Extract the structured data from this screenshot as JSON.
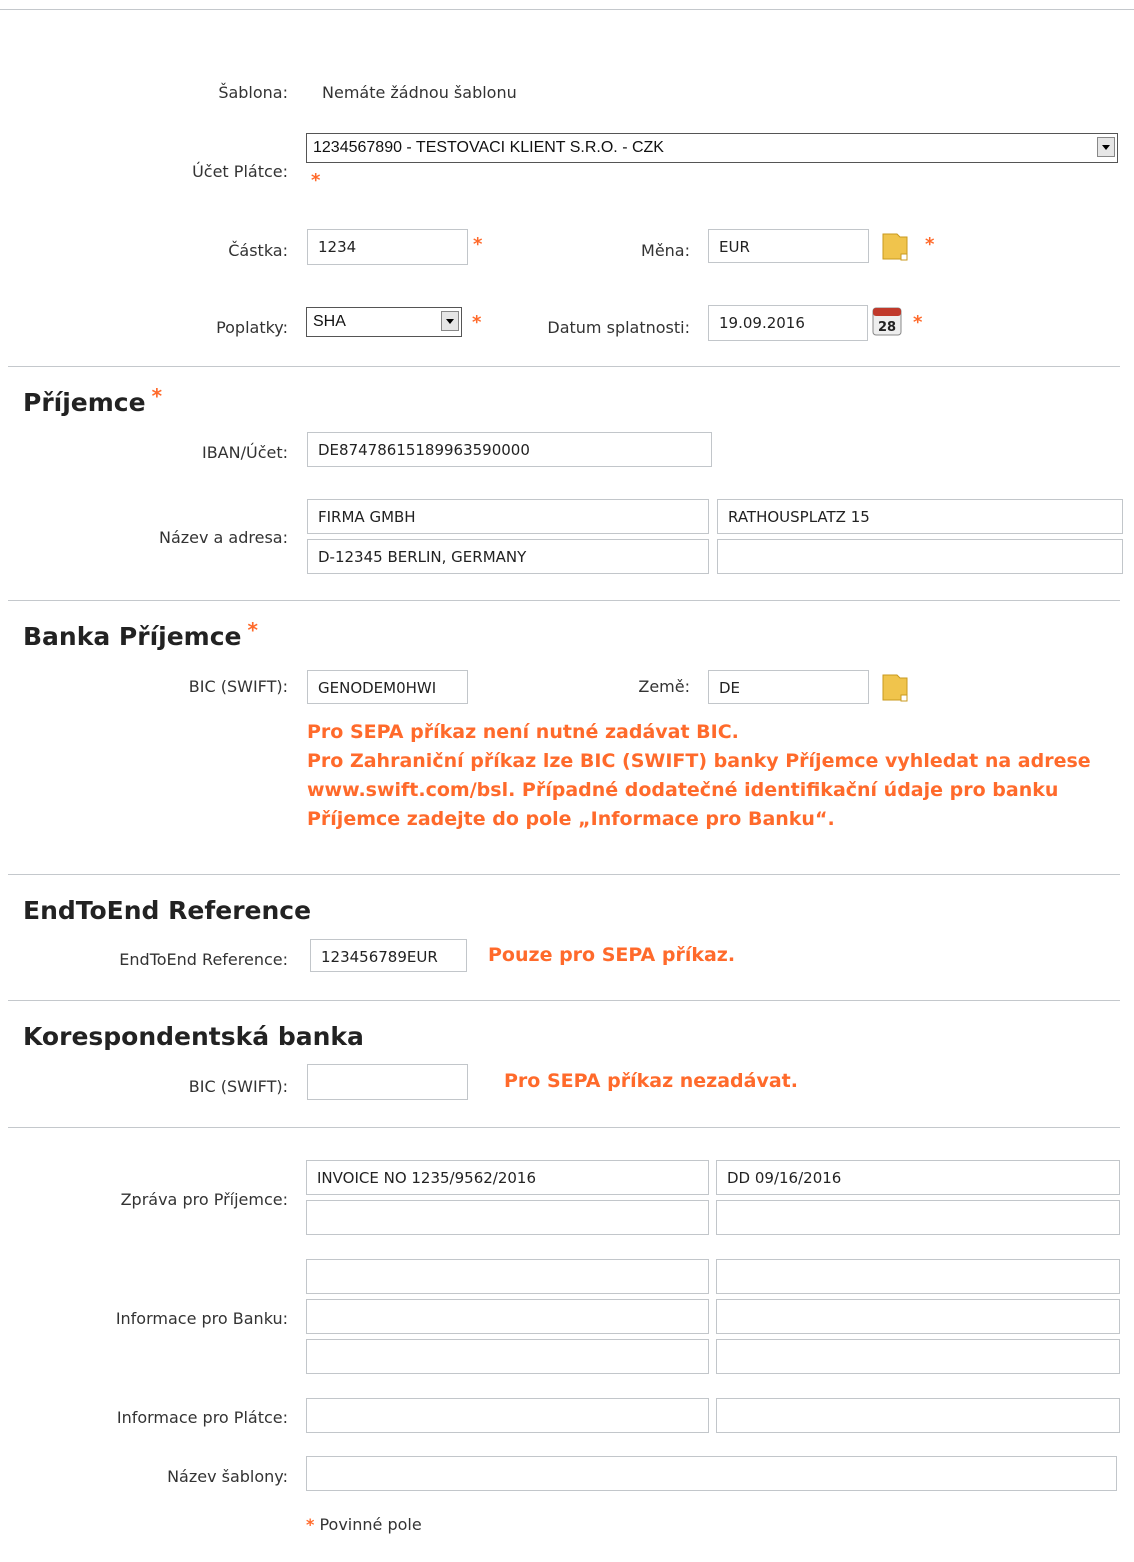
{
  "sablona": {
    "label": "Šablona:",
    "value": "Nemáte žádnou šablonu"
  },
  "ucet": {
    "label": "Účet Plátce:",
    "selected": "1234567890 - TESTOVACI KLIENT S.R.O. - CZK"
  },
  "castka": {
    "label": "Částka:",
    "value": "1234"
  },
  "mena": {
    "label": "Měna:",
    "value": "EUR"
  },
  "poplatky": {
    "label": "Poplatky:",
    "selected": "SHA"
  },
  "datum": {
    "label": "Datum splatnosti:",
    "value": "19.09.2016",
    "calendar_day": "28"
  },
  "required_mark": "*",
  "prijemce": {
    "heading": "Příjemce",
    "iban_label": "IBAN/Účet:",
    "iban_value": "DE87478615189963590000",
    "name_label": "Název a adresa:",
    "name_fields": [
      "FIRMA GMBH",
      "RATHOUSPLATZ 15",
      "D-12345 BERLIN, GERMANY",
      ""
    ]
  },
  "banka": {
    "heading": "Banka Příjemce",
    "bic_label": "BIC (SWIFT):",
    "bic_value": "GENODEM0HWI",
    "zeme_label": "Země:",
    "zeme_value": "DE",
    "notes": [
      "Pro SEPA příkaz není nutné zadávat BIC.",
      "Pro Zahraniční příkaz lze BIC (SWIFT) banky Příjemce vyhledat na adrese",
      "www.swift.com/bsl. Případné dodatečné identifikační údaje pro banku",
      "Příjemce zadejte do pole „Informace pro Banku“."
    ]
  },
  "endtoend": {
    "heading": "EndToEnd Reference",
    "label": "EndToEnd Reference:",
    "value": "123456789EUR",
    "note": "Pouze pro SEPA příkaz."
  },
  "koresp": {
    "heading": "Korespondentská banka",
    "label": "BIC (SWIFT):",
    "value": "",
    "note": "Pro SEPA příkaz nezadávat."
  },
  "zprava": {
    "label": "Zpráva pro Příjemce:",
    "fields": [
      "INVOICE NO 1235/9562/2016",
      "DD 09/16/2016",
      "",
      ""
    ]
  },
  "info_banka": {
    "label": "Informace pro Banku:",
    "fields": [
      "",
      "",
      "",
      "",
      "",
      ""
    ]
  },
  "info_platce": {
    "label": "Informace pro Plátce:",
    "fields": [
      "",
      ""
    ]
  },
  "nazev_sablony": {
    "label": "Název šablony:",
    "value": ""
  },
  "footer": {
    "required_note": "Povinné pole"
  },
  "colors": {
    "accent": "#ff6a2b",
    "rule": "#c4c8cc",
    "text": "#333333"
  },
  "icons": {
    "currency_picker": "folder-icon",
    "country_picker": "folder-icon",
    "date_picker": "calendar-icon"
  }
}
